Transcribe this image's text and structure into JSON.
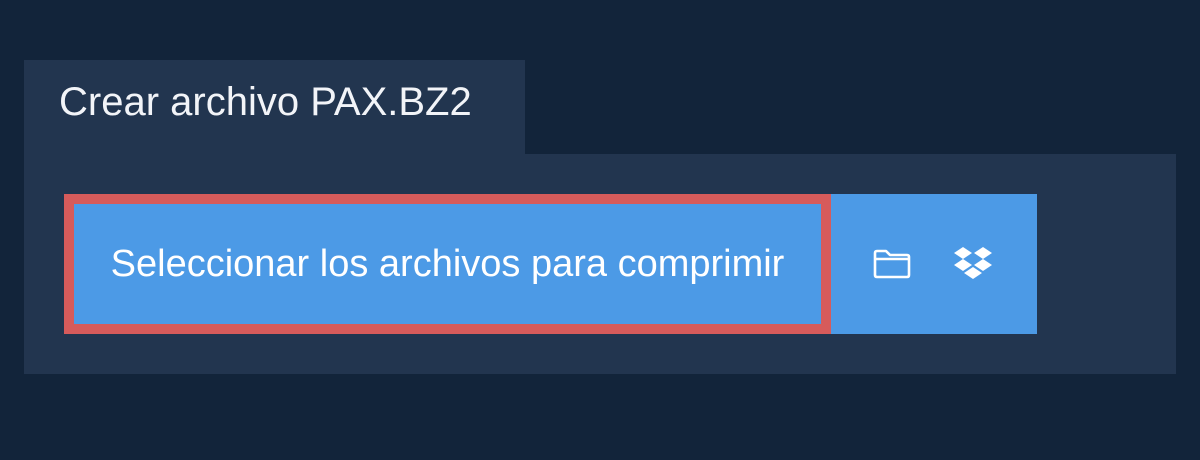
{
  "tab": {
    "title": "Crear archivo PAX.BZ2"
  },
  "main": {
    "select_button_label": "Seleccionar los archivos para comprimir",
    "icons": [
      "folder-icon",
      "dropbox-icon"
    ]
  },
  "colors": {
    "background": "#12243a",
    "panel": "#22354f",
    "button": "#4c9ae6",
    "highlight_border": "#d65b5b",
    "text": "#ffffff"
  }
}
